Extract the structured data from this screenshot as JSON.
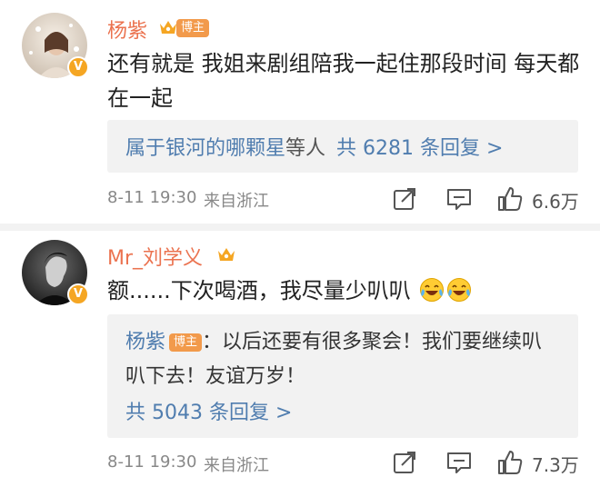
{
  "comments": [
    {
      "username": "杨紫",
      "badge": "博主",
      "text": "还有就是 我姐来剧组陪我一起住那段时间 每天都在一起",
      "reply_prefix": "属于银河的哪颗星",
      "reply_middle": "等人",
      "reply_count": "共 6281 条回复 >",
      "date": "8-11 19:30",
      "location": "来自浙江",
      "likes": "6.6万"
    },
    {
      "username": "Mr_刘学义",
      "text": "额......下次喝酒，我尽量少叭叭",
      "emojis": [
        "laugh-cry-emoji",
        "laugh-cry-emoji"
      ],
      "reply_author": "杨紫",
      "reply_author_badge": "博主",
      "reply_text": "：以后还要有很多聚会！我们要继续叭叭下去！友谊万岁！",
      "reply_count": "共 5043 条回复 >",
      "date": "8-11 19:30",
      "location": "来自浙江",
      "likes": "7.3万"
    }
  ],
  "colors": {
    "username": "#eb7350",
    "link": "#507daf",
    "badge": "#f29a4b",
    "meta": "#888888",
    "reply_bg": "#f2f2f2"
  },
  "icons": [
    "share-icon",
    "comment-icon",
    "like-icon",
    "verified-badge-icon",
    "crown-icon"
  ]
}
